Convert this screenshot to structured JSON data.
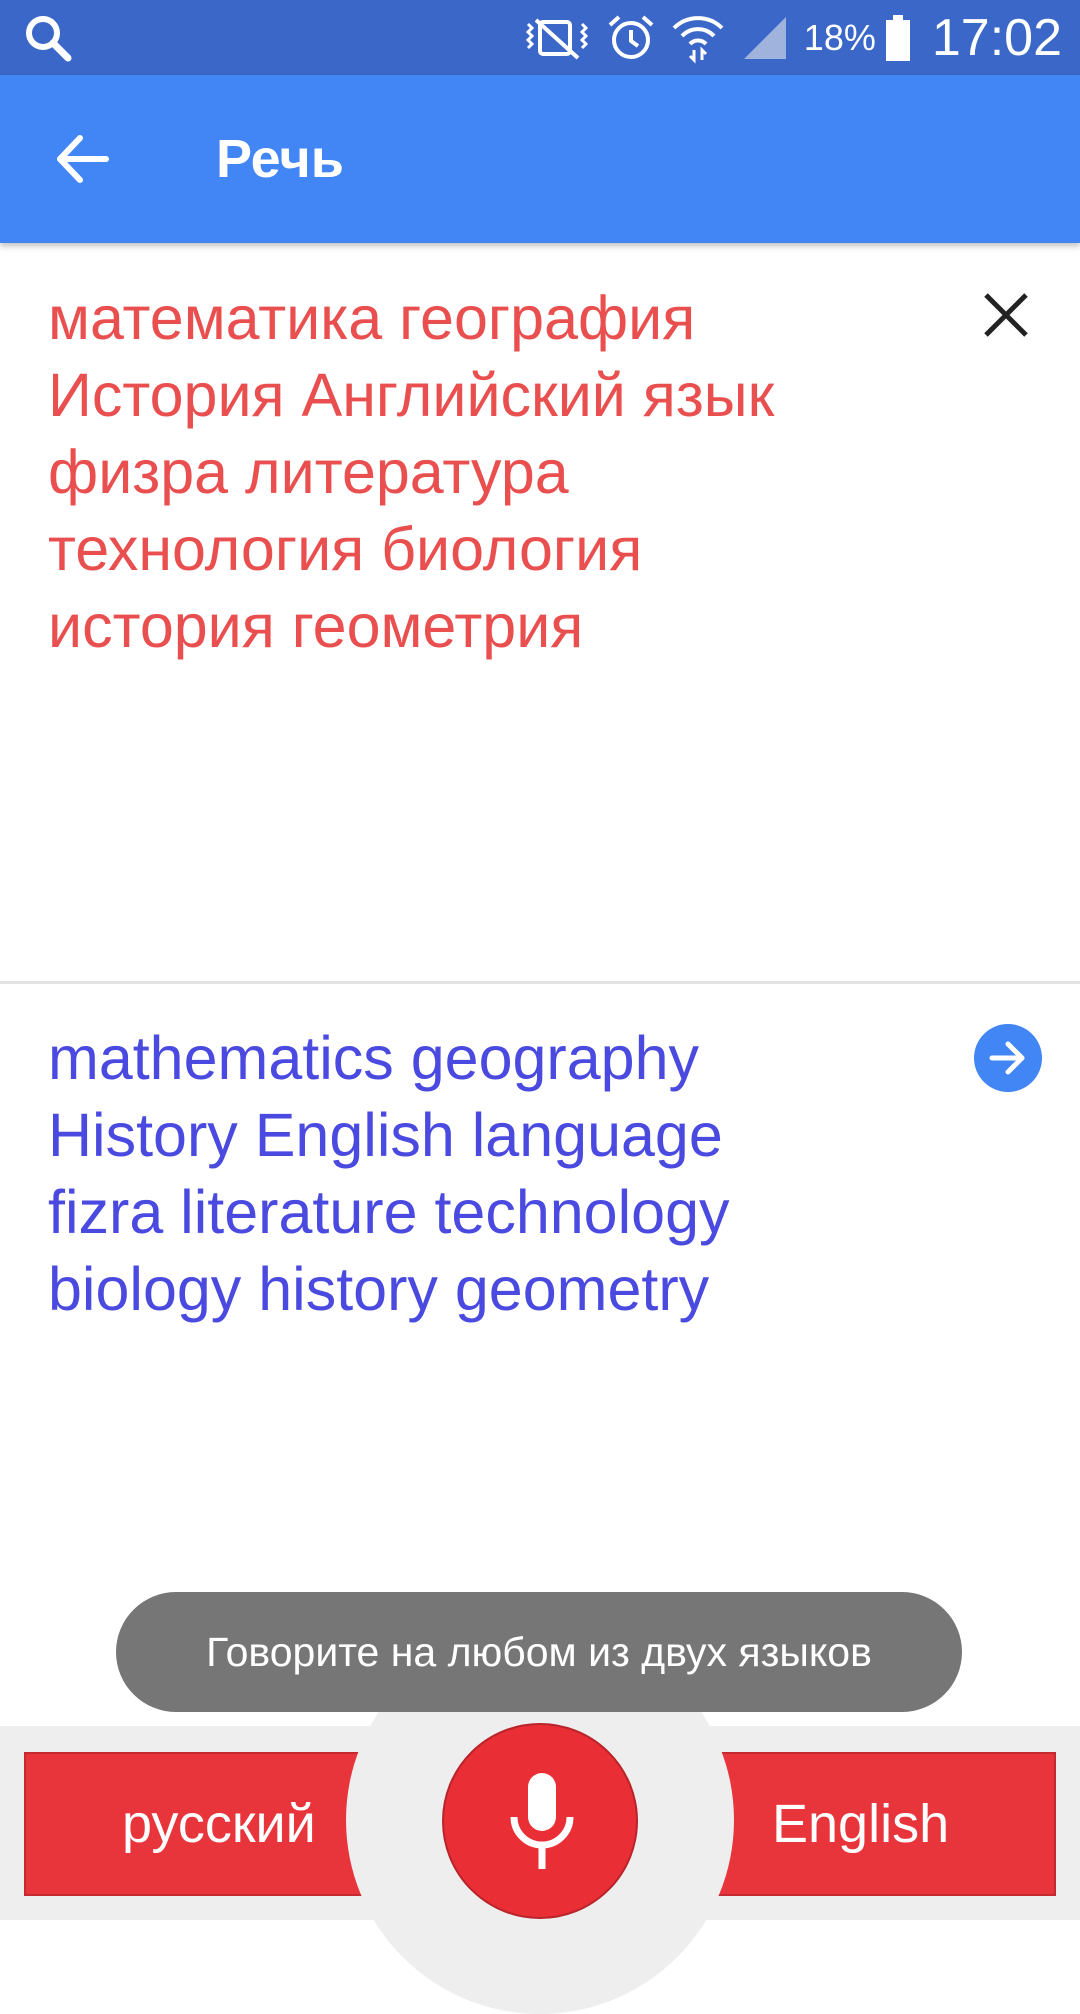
{
  "status_bar": {
    "battery_percent": "18%",
    "time": "17:02",
    "icons": [
      "search-icon",
      "vibrate-mute-icon",
      "alarm-icon",
      "wifi-icon",
      "signal-icon",
      "battery-icon"
    ]
  },
  "app_bar": {
    "title": "Речь",
    "back_icon": "arrow-back-icon"
  },
  "source": {
    "text": "математика география\nИстория Английский язык\nфизра литература\nтехнология биология\nистория геометрия",
    "color": "#ea4f4f"
  },
  "translation": {
    "text": "mathematics geography\nHistory English language\nfizra literature technology\nbiology history geometry",
    "color": "#4a4ae0"
  },
  "toast": {
    "message": "Говорите на любом из двух языков"
  },
  "bottom_bar": {
    "left_language": "русский",
    "right_language": "English",
    "mic_icon": "microphone-icon",
    "accent_color": "#e8353c"
  }
}
